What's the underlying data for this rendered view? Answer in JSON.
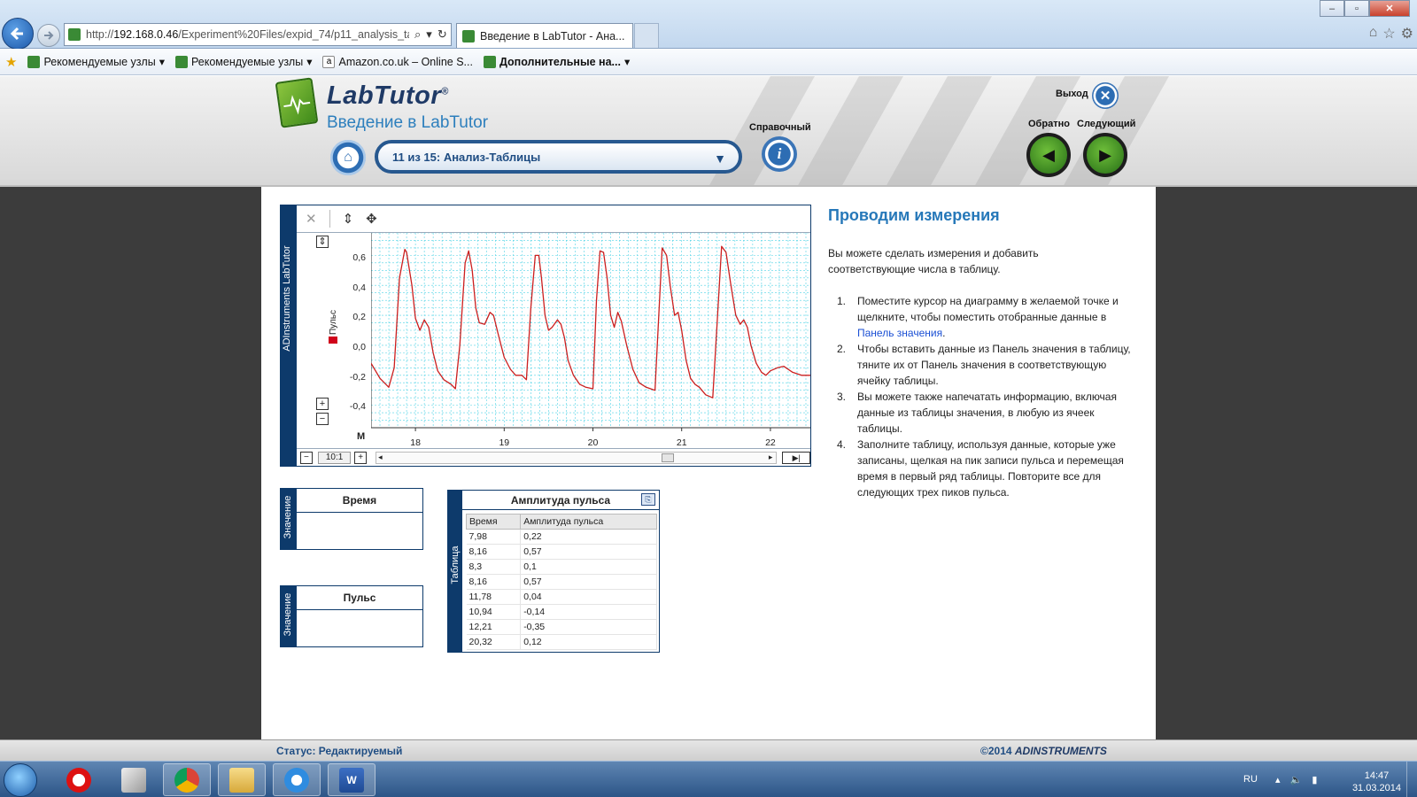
{
  "browser": {
    "url_prefix": "http://",
    "url_host": "192.168.0.46",
    "url_path": "/Experiment%20Files/expid_74/p11_analysis_table.",
    "tab_title": "Введение в LabTutor - Ана...",
    "favorites": [
      {
        "label": "Рекомендуемые узлы",
        "dropdown": "▾"
      },
      {
        "label": "Рекомендуемые узлы",
        "dropdown": "▾"
      },
      {
        "label": "Amazon.co.uk – Online S...",
        "dropdown": ""
      },
      {
        "label": "Дополнительные на...",
        "dropdown": "▾"
      }
    ]
  },
  "labtutor": {
    "brand": "LabTutor",
    "course_title": "Введение в LabTutor",
    "page_selector": "11 из 15: Анализ-Таблицы",
    "reference_label": "Справочный",
    "exit_label": "Выход",
    "prev_label": "Обратно",
    "next_label": "Следующий"
  },
  "chart_panel": {
    "side_label": "ADInstruments LabTutor",
    "legend": "Пульс",
    "ratio": "10:1",
    "y_ticks": [
      "0,6",
      "0,4",
      "0,2",
      "0,0",
      "-0,2",
      "-0,4"
    ],
    "x_ticks": [
      "18",
      "19",
      "20",
      "21",
      "22"
    ],
    "marker": "M"
  },
  "chart_data": {
    "type": "line",
    "title": "",
    "xlabel": "",
    "ylabel": "",
    "xlim": [
      17.5,
      22.45
    ],
    "ylim": [
      -0.55,
      0.75
    ],
    "series": [
      {
        "name": "Пульс",
        "color": "#cc1f1f",
        "x": [
          17.5,
          17.6,
          17.7,
          17.76,
          17.82,
          17.88,
          17.9,
          17.96,
          18.0,
          18.05,
          18.1,
          18.15,
          18.2,
          18.25,
          18.32,
          18.4,
          18.45,
          18.5,
          18.56,
          18.6,
          18.64,
          18.68,
          18.72,
          18.78,
          18.84,
          18.88,
          18.93,
          19.0,
          19.07,
          19.13,
          19.2,
          19.25,
          19.3,
          19.35,
          19.39,
          19.42,
          19.46,
          19.5,
          19.54,
          19.6,
          19.64,
          19.68,
          19.72,
          19.78,
          19.85,
          19.92,
          20.0,
          20.04,
          20.08,
          20.12,
          20.16,
          20.2,
          20.24,
          20.28,
          20.32,
          20.38,
          20.45,
          20.52,
          20.6,
          20.7,
          20.78,
          20.83,
          20.87,
          20.92,
          20.96,
          21.0,
          21.05,
          21.1,
          21.15,
          21.2,
          21.27,
          21.35,
          21.45,
          21.5,
          21.55,
          21.61,
          21.66,
          21.7,
          21.74,
          21.78,
          21.84,
          21.9,
          21.95,
          22.0,
          22.08,
          22.15,
          22.25,
          22.35,
          22.45
        ],
        "values": [
          -0.12,
          -0.22,
          -0.28,
          -0.15,
          0.45,
          0.64,
          0.62,
          0.4,
          0.18,
          0.1,
          0.17,
          0.12,
          -0.05,
          -0.17,
          -0.23,
          -0.26,
          -0.29,
          0.0,
          0.55,
          0.63,
          0.5,
          0.25,
          0.15,
          0.14,
          0.22,
          0.2,
          0.08,
          -0.08,
          -0.16,
          -0.2,
          -0.2,
          -0.23,
          0.25,
          0.6,
          0.6,
          0.45,
          0.2,
          0.1,
          0.12,
          0.17,
          0.14,
          0.05,
          -0.1,
          -0.2,
          -0.26,
          -0.28,
          -0.29,
          0.3,
          0.63,
          0.62,
          0.45,
          0.2,
          0.12,
          0.22,
          0.16,
          0.0,
          -0.16,
          -0.25,
          -0.28,
          -0.3,
          0.65,
          0.6,
          0.4,
          0.2,
          0.22,
          0.1,
          -0.1,
          -0.22,
          -0.26,
          -0.28,
          -0.33,
          -0.35,
          0.66,
          0.62,
          0.42,
          0.2,
          0.14,
          0.17,
          0.12,
          0.0,
          -0.12,
          -0.18,
          -0.2,
          -0.17,
          -0.15,
          -0.14,
          -0.18,
          -0.2,
          -0.2
        ]
      }
    ]
  },
  "value_panels": {
    "time_header": "Время",
    "pulse_header": "Пульс",
    "side_label": "Значение"
  },
  "table_panel": {
    "title": "Амплитуда пульса",
    "side_label": "Таблица",
    "columns": [
      "Время",
      "Амплитуда пульса"
    ],
    "rows": [
      [
        "7,98",
        "0,22"
      ],
      [
        "8,16",
        "0,57"
      ],
      [
        "8,3",
        "0,1"
      ],
      [
        "8,16",
        "0,57"
      ],
      [
        "11,78",
        "0,04"
      ],
      [
        "10,94",
        "-0,14"
      ],
      [
        "12,21",
        "-0,35"
      ],
      [
        "20,32",
        "0,12"
      ]
    ]
  },
  "instructions": {
    "title": "Проводим измерения",
    "intro": "Вы можете сделать измерения и добавить соответствующие числа в таблицу.",
    "steps": [
      {
        "n": "1.",
        "text_before": "Поместите курсор на диаграмму в желаемой точке и щелкните, чтобы поместить отобранные данные в ",
        "link": "Панель значения",
        "text_after": "."
      },
      {
        "n": "2.",
        "text_before": "Чтобы вставить данные из Панель значения в таблицу, тяните их от Панель значения в соответствующую ячейку таблицы.",
        "link": "",
        "text_after": ""
      },
      {
        "n": "3.",
        "text_before": "Вы можете также напечатать информацию, включая данные из таблицы значения, в любую из ячеек таблицы.",
        "link": "",
        "text_after": ""
      },
      {
        "n": "4.",
        "text_before": "Заполните таблицу, используя данные, которые уже записаны, щелкая на пик записи пульса и перемещая время в первый ряд таблицы. Повторите все для следующих трех пиков пульса.",
        "link": "",
        "text_after": ""
      }
    ]
  },
  "status": {
    "text": "Статус: Редактируемый",
    "copyright_year": "©2014 ",
    "copyright_brand": "ADINSTRUMENTS"
  },
  "taskbar": {
    "lang": "RU",
    "time": "14:47",
    "date": "31.03.2014"
  }
}
